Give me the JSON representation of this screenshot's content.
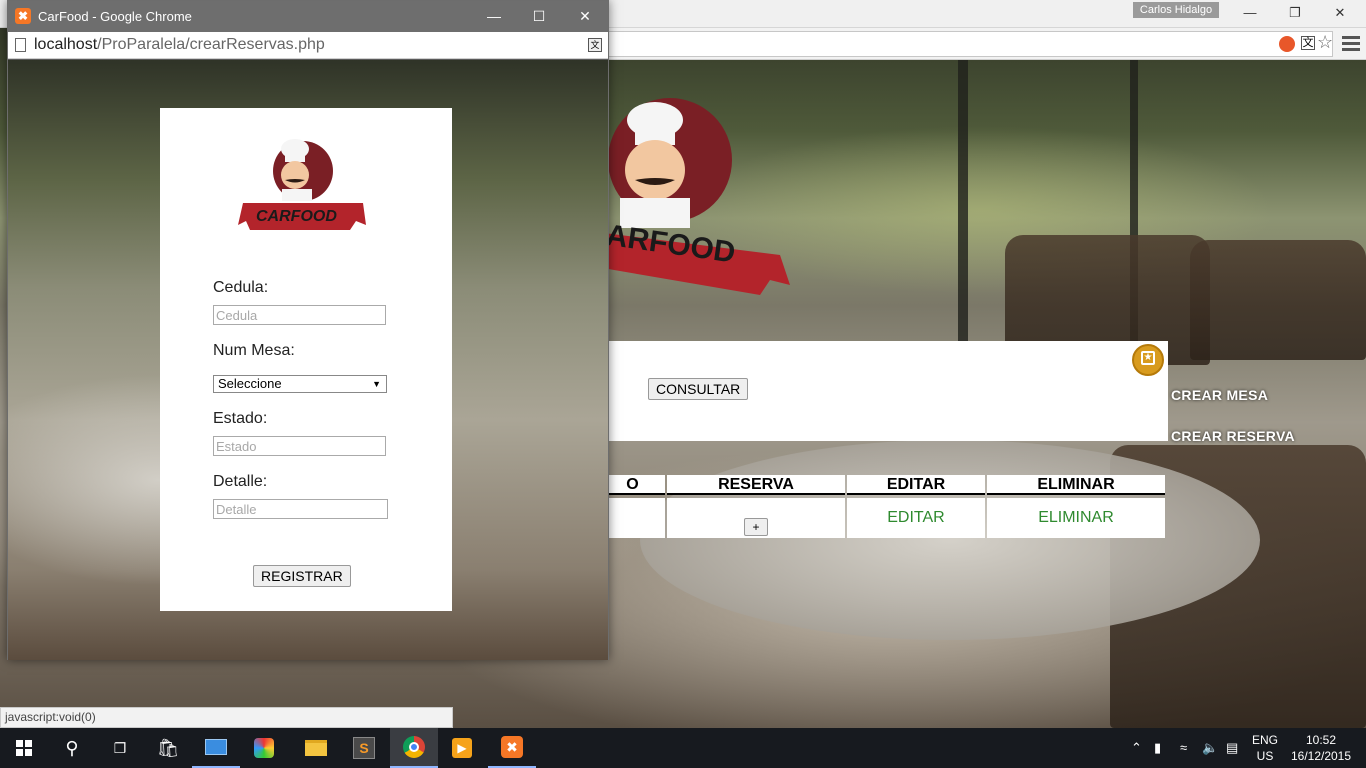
{
  "popup": {
    "window_title": "CarFood - Google Chrome",
    "url_host": "localhost",
    "url_path": "/ProParalela/crearReservas.php",
    "logo_text": "CARFOOD",
    "form": {
      "cedula_label": "Cedula:",
      "cedula_placeholder": "Cedula",
      "mesa_label": "Num Mesa:",
      "mesa_selected": "Seleccione",
      "estado_label": "Estado:",
      "estado_placeholder": "Estado",
      "detalle_label": "Detalle:",
      "detalle_placeholder": "Detalle",
      "submit_label": "REGISTRAR"
    }
  },
  "background_window": {
    "user_name": "Carlos Hidalgo",
    "logo_text": "ARFOOD",
    "consultar_label": "CONSULTAR",
    "side_links": [
      "CREAR MESA",
      "CREAR RESERVA"
    ],
    "table": {
      "headers": [
        "O",
        "RESERVA",
        "EDITAR",
        "ELIMINAR"
      ],
      "row": {
        "add_label": "+",
        "edit_label": "EDITAR",
        "delete_label": "ELIMINAR"
      }
    },
    "status_text": "javascript:void(0)"
  },
  "taskbar": {
    "language_top": "ENG",
    "language_bottom": "US",
    "time": "10:52",
    "date": "16/12/2015"
  },
  "colors": {
    "link_green": "#2f8a2f",
    "logo_red": "#9e1b22",
    "taskbar": "#171a1f"
  }
}
